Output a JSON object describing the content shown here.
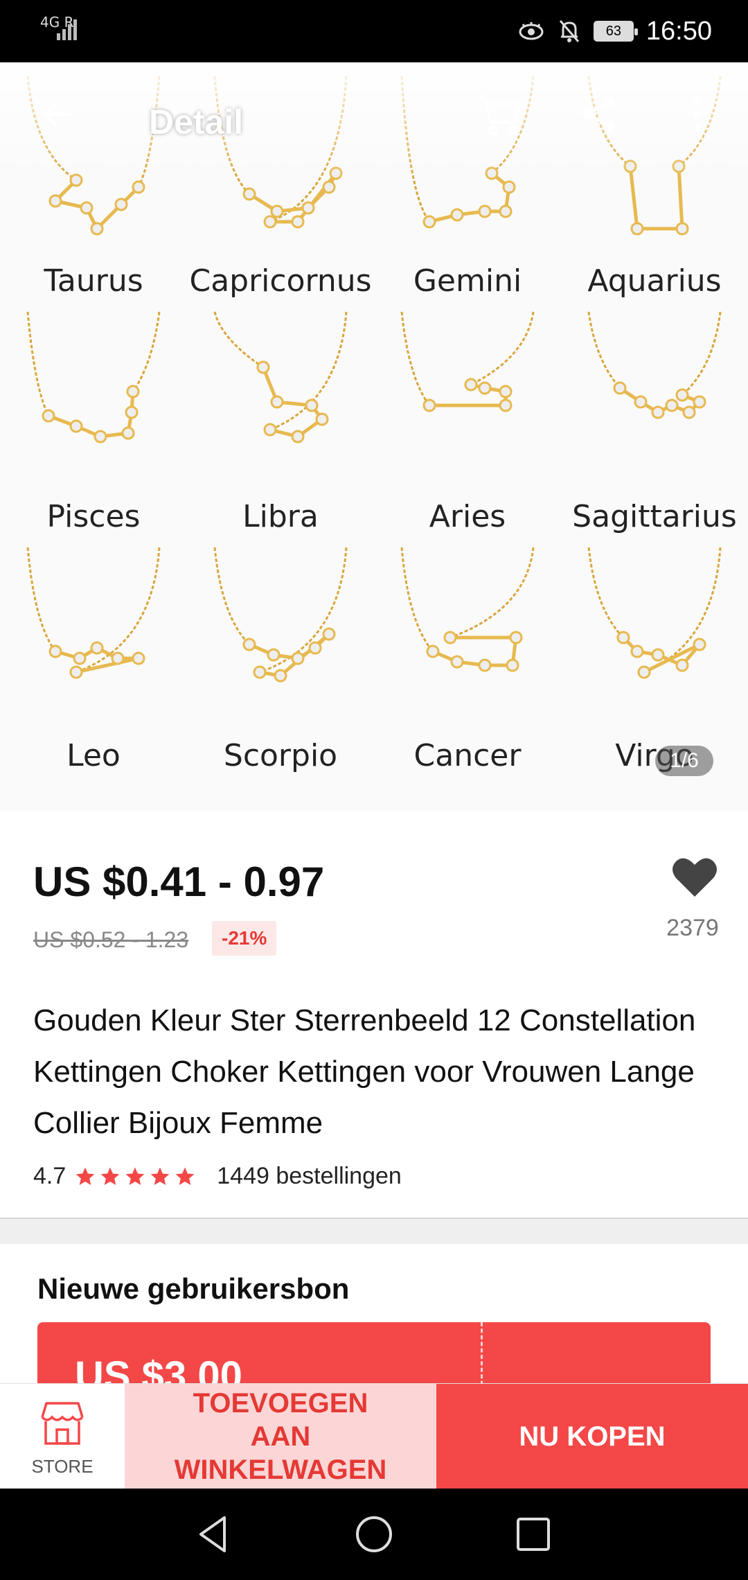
{
  "status_bar": {
    "network": "4G R",
    "battery": "63",
    "time": "16:50"
  },
  "header": {
    "title": "Detail",
    "icons": [
      "back-arrow-icon",
      "cart-icon",
      "share-icon",
      "more-vertical-icon"
    ]
  },
  "gallery": {
    "signs": [
      "Taurus",
      "Capricornus",
      "Gemini",
      "Aquarius",
      "Pisces",
      "Libra",
      "Aries",
      "Sagittarius",
      "Leo",
      "Scorpio",
      "Cancer",
      "Virgo"
    ],
    "pager": "1/6",
    "pendant_color": "#e7b94f",
    "chain_color": "#d9a63a"
  },
  "product": {
    "price": "US $0.41 - 0.97",
    "original_price": "US $0.52 - 1.23",
    "discount": "-21%",
    "wishlist_count": "2379",
    "title": "Gouden Kleur Ster Sterrenbeeld 12 Constellation Kettingen Choker Kettingen voor Vrouwen Lange Collier Bijoux Femme",
    "rating": "4.7",
    "stars": 5,
    "orders": "1449 bestellingen"
  },
  "coupon": {
    "title": "Nieuwe gebruikersbon",
    "amount": "US $3.00",
    "color": "#f44747"
  },
  "actions": {
    "store_label": "STORE",
    "add_to_cart": "TOEVOEGEN AAN WINKELWAGEN",
    "buy_now": "NU KOPEN"
  },
  "nav": {
    "icons": [
      "nav-back-icon",
      "nav-home-icon",
      "nav-recents-icon"
    ]
  }
}
